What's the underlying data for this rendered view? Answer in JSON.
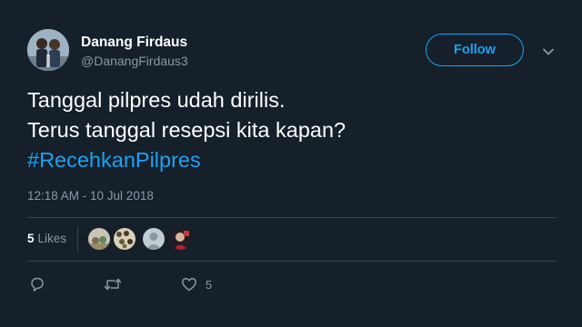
{
  "author": {
    "name": "Danang Firdaus",
    "handle": "@DanangFirdaus3"
  },
  "follow_label": "Follow",
  "tweet": {
    "lines": [
      "Tanggal pilpres udah dirilis.",
      "Terus tanggal resepsi kita kapan?"
    ],
    "hashtag": "#RecehkanPilpres"
  },
  "timestamp": "12:18 AM - 10 Jul 2018",
  "likes": {
    "count": "5",
    "label": "Likes"
  },
  "actions": {
    "reply_icon": "reply-icon",
    "retweet_icon": "retweet-icon",
    "like_icon": "heart-icon",
    "like_count": "5"
  },
  "colors": {
    "background": "#15202b",
    "accent": "#1da1f2",
    "secondary_text": "#8899a6",
    "divider": "#38444d"
  }
}
